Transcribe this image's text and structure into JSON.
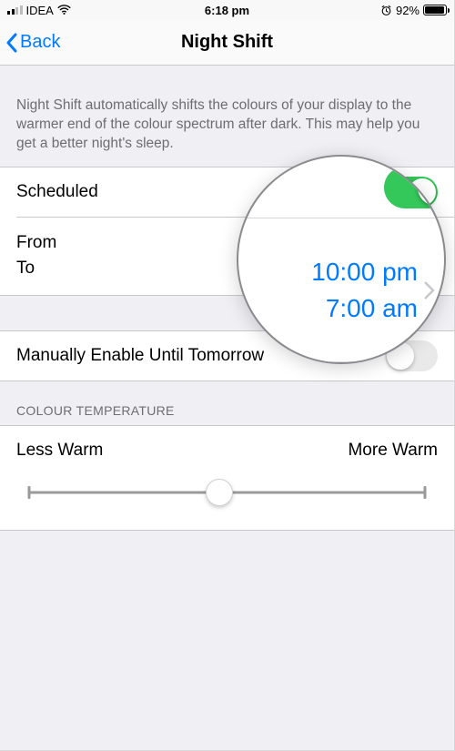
{
  "statusbar": {
    "carrier": "IDEA",
    "time": "6:18 pm",
    "battery_pct": "92%"
  },
  "nav": {
    "back": "Back",
    "title": "Night Shift"
  },
  "description": "Night Shift automatically shifts the colours of your display to the warmer end of the colour spectrum after dark. This may help you get a better night's sleep.",
  "schedule": {
    "scheduled_label": "Scheduled",
    "scheduled_on": true,
    "from_label": "From",
    "to_label": "To",
    "from_value": "10:00 pm",
    "to_value": "7:00 am"
  },
  "manual": {
    "label": "Manually Enable Until Tomorrow",
    "on": false
  },
  "temp": {
    "header": "COLOUR TEMPERATURE",
    "less": "Less Warm",
    "more": "More Warm",
    "slider_pos": 0.48
  },
  "magnifier": {
    "from": "10:00 pm",
    "to": "7:00 am"
  }
}
